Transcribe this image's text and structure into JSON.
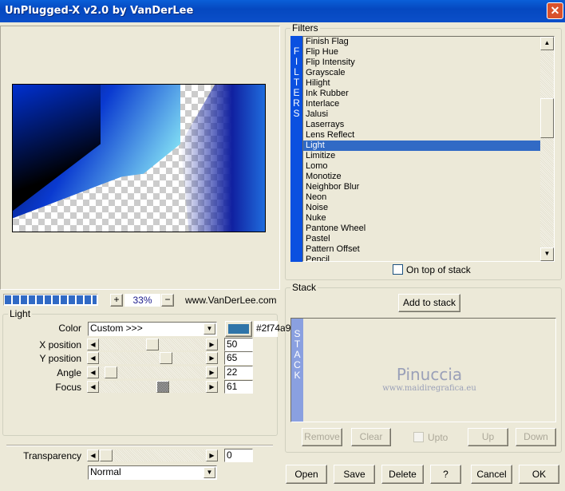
{
  "window": {
    "title": "UnPlugged-X v2.0 by VanDerLee",
    "close": "✕"
  },
  "preview": {
    "zoom": "33%",
    "zoom_in": "+",
    "zoom_out": "−",
    "website": "www.VanDerLee.com",
    "progress_segments": 12,
    "progress_percent": 100
  },
  "light": {
    "group": "Light",
    "color_label": "Color",
    "color_value": "Custom >>>",
    "color_hex": "#2f74a9",
    "swatch": "#2f74a9",
    "params": [
      {
        "label": "X position",
        "value": "50",
        "pct": 50
      },
      {
        "label": "Y position",
        "value": "65",
        "pct": 65
      },
      {
        "label": "Angle",
        "value": "22",
        "pct": 5
      },
      {
        "label": "Focus",
        "value": "61",
        "pct": 61
      }
    ]
  },
  "transparency": {
    "label": "Transparency",
    "value": "0",
    "pct": 0,
    "blend": "Normal"
  },
  "filters": {
    "group": "Filters",
    "vertical_label": "FILTERS",
    "selected": "Light",
    "items": [
      "Finish Flag",
      "Flip Hue",
      "Flip Intensity",
      "Grayscale",
      "Hilight",
      "Ink Rubber",
      "Interlace",
      "Jalusi",
      "Laserrays",
      "Lens Reflect",
      "Light",
      "Limitize",
      "Lomo",
      "Monotize",
      "Neighbor Blur",
      "Neon",
      "Noise",
      "Nuke",
      "Pantone Wheel",
      "Pastel",
      "Pattern Offset",
      "Pencil"
    ],
    "on_top_label": "On top of stack",
    "on_top_checked": false
  },
  "stack": {
    "group": "Stack",
    "add": "Add to stack",
    "vertical_label": "STACK",
    "watermark": "Pinuccia",
    "watermark_url": "www.maidiregrafica.eu",
    "remove": "Remove",
    "clear": "Clear",
    "upto": "Upto",
    "up": "Up",
    "down": "Down"
  },
  "buttons": {
    "open": "Open",
    "save": "Save",
    "delete": "Delete",
    "help": "?",
    "cancel": "Cancel",
    "ok": "OK"
  }
}
